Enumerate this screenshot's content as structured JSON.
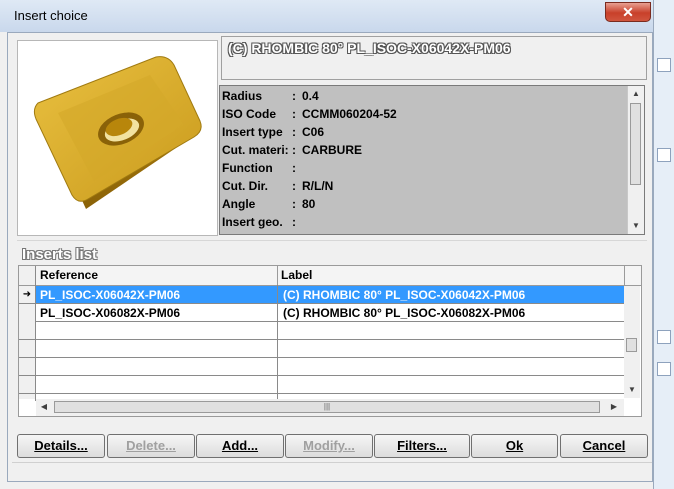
{
  "window": {
    "title": "Insert choice",
    "close_label": "✕"
  },
  "header": {
    "title": "(C) RHOMBIC 80° PL_ISOC-X06042X-PM06"
  },
  "properties": [
    {
      "name": "Radius",
      "value": "0.4"
    },
    {
      "name": "ISO Code",
      "value": "CCMM060204-52"
    },
    {
      "name": "Insert type",
      "value": "C06"
    },
    {
      "name": "Cut. materi:",
      "value": "CARBURE"
    },
    {
      "name": "Function",
      "value": ""
    },
    {
      "name": "Cut. Dir.",
      "value": "R/L/N"
    },
    {
      "name": "Angle",
      "value": "80"
    },
    {
      "name": "Insert geo.",
      "value": ""
    }
  ],
  "inserts_list": {
    "legend": "Inserts list",
    "columns": [
      "Reference",
      "Label"
    ],
    "rows": [
      {
        "reference": "PL_ISOC-X06042X-PM06",
        "label": "(C) RHOMBIC 80° PL_ISOC-X06042X-PM06",
        "selected": true
      },
      {
        "reference": "PL_ISOC-X06082X-PM06",
        "label": "(C) RHOMBIC 80° PL_ISOC-X06082X-PM06",
        "selected": false
      }
    ]
  },
  "buttons": {
    "details": "Details...",
    "delete": "Delete...",
    "add": "Add...",
    "modify": "Modify...",
    "filters": "Filters...",
    "ok": "Ok",
    "cancel": "Cancel"
  },
  "colors": {
    "insert_gold": "#d9a520",
    "props_bg": "#c0c0c0",
    "selected_row": "#3399ff"
  }
}
